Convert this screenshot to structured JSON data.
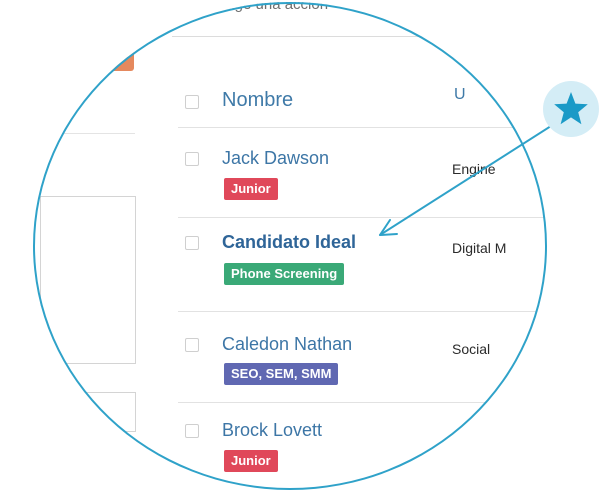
{
  "toolbar": {
    "action_text": "Elige una acción"
  },
  "table": {
    "header_name": "Nombre",
    "header_clipped": "U"
  },
  "candidates": [
    {
      "name": "Jack Dawson",
      "tag": "Junior",
      "tag_color": "#e0485a",
      "role": "Engine"
    },
    {
      "name": "Candidato Ideal",
      "tag": "Phone Screening",
      "tag_color": "#3aa977",
      "role": "Digital M"
    },
    {
      "name": "Caledon Nathan",
      "tag": "SEO, SEM, SMM",
      "tag_color": "#6068b2",
      "role": "Social"
    },
    {
      "name": "Brock Lovett",
      "tag": "Junior",
      "tag_color": "#e0485a",
      "role": ""
    }
  ],
  "colors": {
    "accent": "#2fa2c9",
    "badge_bg": "#d4edf6",
    "link": "#3d76a6",
    "orange_button": "#e5895e"
  },
  "icons": {
    "badge": "star-icon"
  }
}
